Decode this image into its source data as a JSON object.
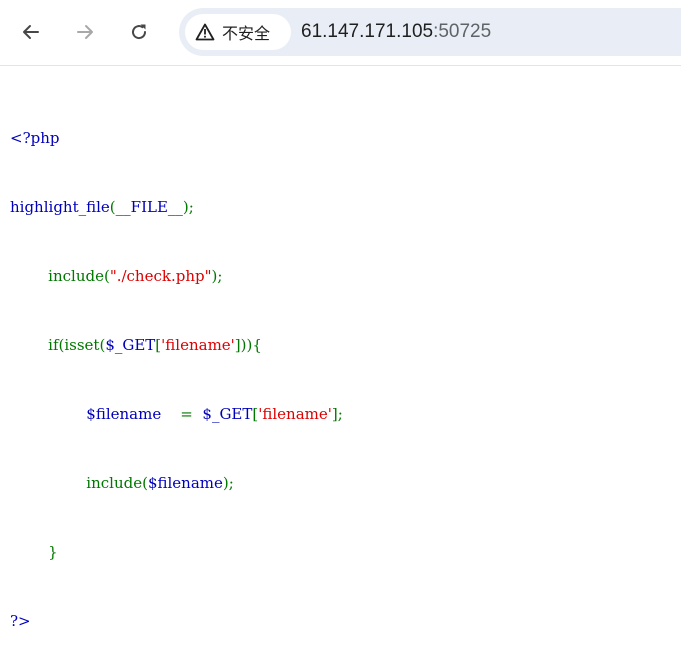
{
  "toolbar": {
    "back_icon": "arrow-left-icon",
    "forward_icon": "arrow-right-icon",
    "reload_icon": "reload-icon",
    "security_icon": "warning-triangle-icon",
    "security_label": "不安全",
    "url_host": "61.147.171.105",
    "url_port": ":50725"
  },
  "colors": {
    "default": "#0000BB",
    "keyword": "#007700",
    "string": "#DD0000"
  },
  "code": {
    "line1": [
      "<?php"
    ],
    "line2": [
      "highlight_file",
      "(",
      "__FILE__",
      ");"
    ],
    "line3": [
      "        ",
      "include",
      "(",
      "\"./check.php\"",
      ");"
    ],
    "line4": [
      "        ",
      "if(isset(",
      "$_GET",
      "[",
      "'filename'",
      "])){"
    ],
    "line5": [
      "                ",
      "$filename    ",
      "=  ",
      "$_GET",
      "[",
      "'filename'",
      "];"
    ],
    "line6": [
      "                ",
      "include(",
      "$filename",
      ");"
    ],
    "line7": [
      "        ",
      "}"
    ],
    "line8": [
      "?>"
    ]
  }
}
